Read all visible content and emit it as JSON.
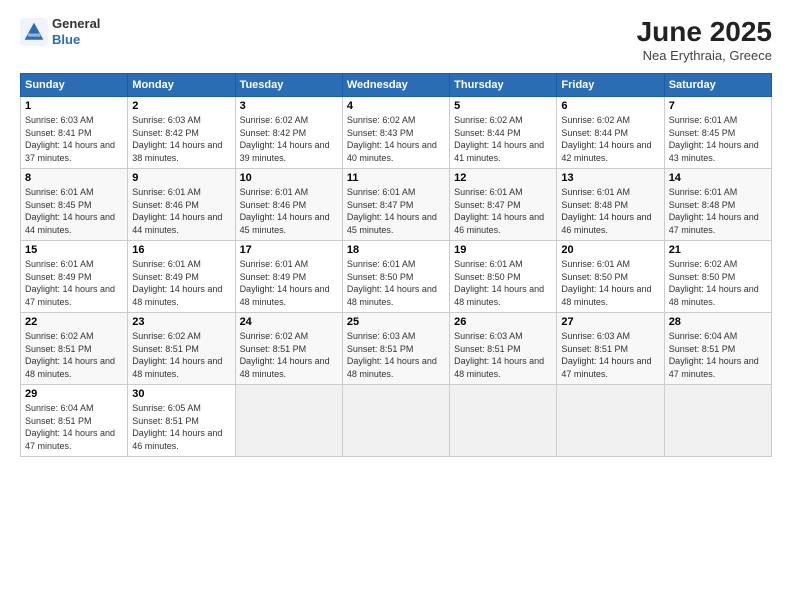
{
  "header": {
    "logo_line1": "General",
    "logo_line2": "Blue",
    "month_year": "June 2025",
    "location": "Nea Erythraia, Greece"
  },
  "weekdays": [
    "Sunday",
    "Monday",
    "Tuesday",
    "Wednesday",
    "Thursday",
    "Friday",
    "Saturday"
  ],
  "weeks": [
    [
      {
        "day": "1",
        "rise": "6:03 AM",
        "set": "8:41 PM",
        "daylight": "14 hours and 37 minutes."
      },
      {
        "day": "2",
        "rise": "6:03 AM",
        "set": "8:42 PM",
        "daylight": "14 hours and 38 minutes."
      },
      {
        "day": "3",
        "rise": "6:02 AM",
        "set": "8:42 PM",
        "daylight": "14 hours and 39 minutes."
      },
      {
        "day": "4",
        "rise": "6:02 AM",
        "set": "8:43 PM",
        "daylight": "14 hours and 40 minutes."
      },
      {
        "day": "5",
        "rise": "6:02 AM",
        "set": "8:44 PM",
        "daylight": "14 hours and 41 minutes."
      },
      {
        "day": "6",
        "rise": "6:02 AM",
        "set": "8:44 PM",
        "daylight": "14 hours and 42 minutes."
      },
      {
        "day": "7",
        "rise": "6:01 AM",
        "set": "8:45 PM",
        "daylight": "14 hours and 43 minutes."
      }
    ],
    [
      {
        "day": "8",
        "rise": "6:01 AM",
        "set": "8:45 PM",
        "daylight": "14 hours and 44 minutes."
      },
      {
        "day": "9",
        "rise": "6:01 AM",
        "set": "8:46 PM",
        "daylight": "14 hours and 44 minutes."
      },
      {
        "day": "10",
        "rise": "6:01 AM",
        "set": "8:46 PM",
        "daylight": "14 hours and 45 minutes."
      },
      {
        "day": "11",
        "rise": "6:01 AM",
        "set": "8:47 PM",
        "daylight": "14 hours and 45 minutes."
      },
      {
        "day": "12",
        "rise": "6:01 AM",
        "set": "8:47 PM",
        "daylight": "14 hours and 46 minutes."
      },
      {
        "day": "13",
        "rise": "6:01 AM",
        "set": "8:48 PM",
        "daylight": "14 hours and 46 minutes."
      },
      {
        "day": "14",
        "rise": "6:01 AM",
        "set": "8:48 PM",
        "daylight": "14 hours and 47 minutes."
      }
    ],
    [
      {
        "day": "15",
        "rise": "6:01 AM",
        "set": "8:49 PM",
        "daylight": "14 hours and 47 minutes."
      },
      {
        "day": "16",
        "rise": "6:01 AM",
        "set": "8:49 PM",
        "daylight": "14 hours and 48 minutes."
      },
      {
        "day": "17",
        "rise": "6:01 AM",
        "set": "8:49 PM",
        "daylight": "14 hours and 48 minutes."
      },
      {
        "day": "18",
        "rise": "6:01 AM",
        "set": "8:50 PM",
        "daylight": "14 hours and 48 minutes."
      },
      {
        "day": "19",
        "rise": "6:01 AM",
        "set": "8:50 PM",
        "daylight": "14 hours and 48 minutes."
      },
      {
        "day": "20",
        "rise": "6:01 AM",
        "set": "8:50 PM",
        "daylight": "14 hours and 48 minutes."
      },
      {
        "day": "21",
        "rise": "6:02 AM",
        "set": "8:50 PM",
        "daylight": "14 hours and 48 minutes."
      }
    ],
    [
      {
        "day": "22",
        "rise": "6:02 AM",
        "set": "8:51 PM",
        "daylight": "14 hours and 48 minutes."
      },
      {
        "day": "23",
        "rise": "6:02 AM",
        "set": "8:51 PM",
        "daylight": "14 hours and 48 minutes."
      },
      {
        "day": "24",
        "rise": "6:02 AM",
        "set": "8:51 PM",
        "daylight": "14 hours and 48 minutes."
      },
      {
        "day": "25",
        "rise": "6:03 AM",
        "set": "8:51 PM",
        "daylight": "14 hours and 48 minutes."
      },
      {
        "day": "26",
        "rise": "6:03 AM",
        "set": "8:51 PM",
        "daylight": "14 hours and 48 minutes."
      },
      {
        "day": "27",
        "rise": "6:03 AM",
        "set": "8:51 PM",
        "daylight": "14 hours and 47 minutes."
      },
      {
        "day": "28",
        "rise": "6:04 AM",
        "set": "8:51 PM",
        "daylight": "14 hours and 47 minutes."
      }
    ],
    [
      {
        "day": "29",
        "rise": "6:04 AM",
        "set": "8:51 PM",
        "daylight": "14 hours and 47 minutes."
      },
      {
        "day": "30",
        "rise": "6:05 AM",
        "set": "8:51 PM",
        "daylight": "14 hours and 46 minutes."
      },
      null,
      null,
      null,
      null,
      null
    ]
  ]
}
